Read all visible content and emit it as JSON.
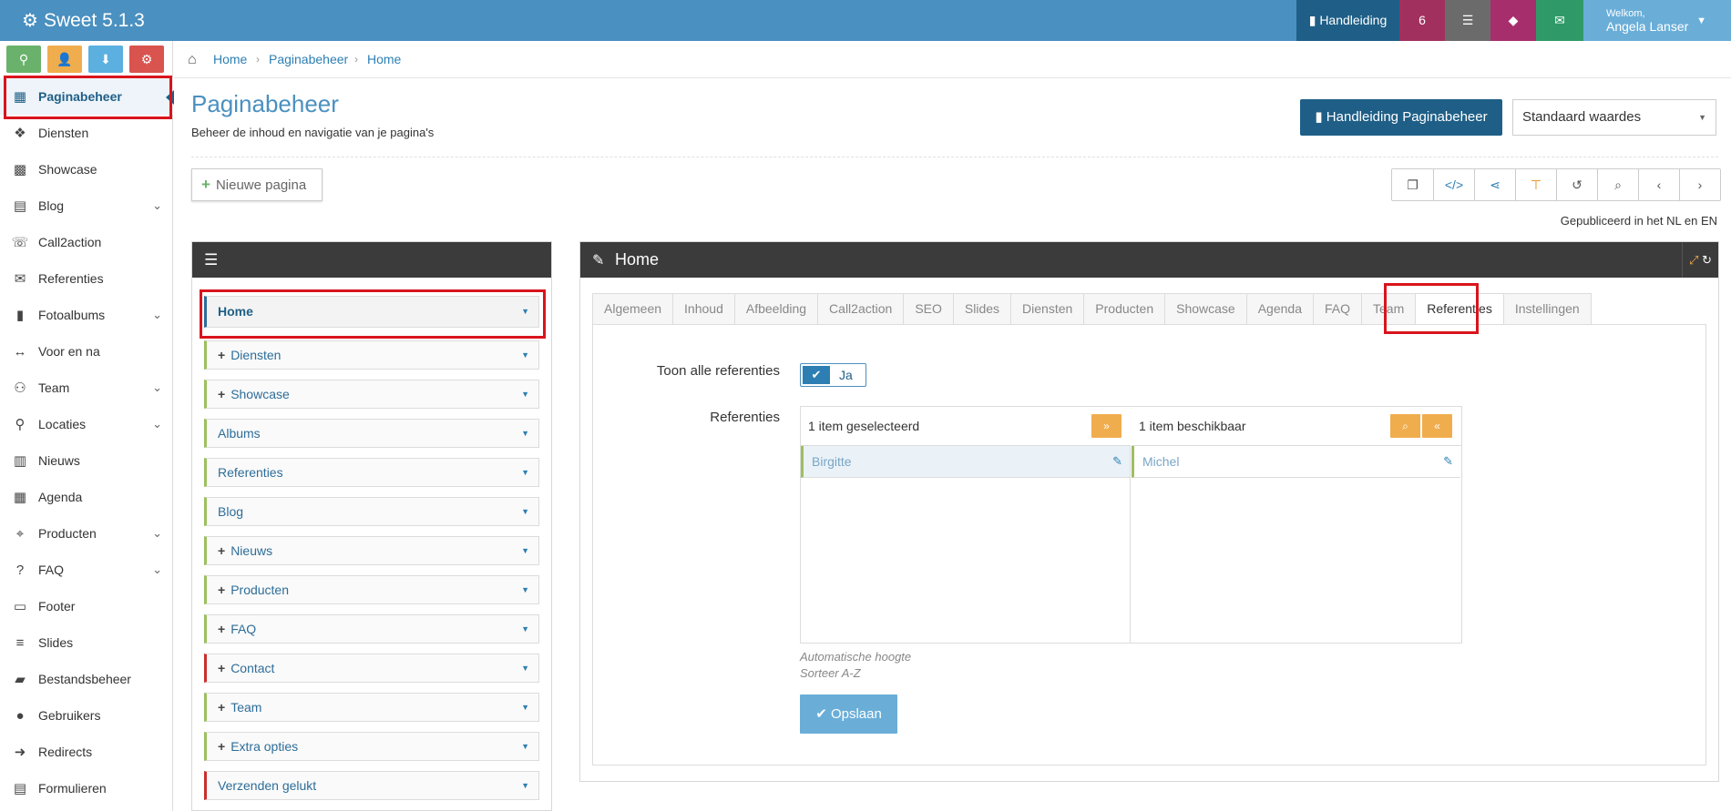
{
  "app": {
    "title": "Sweet 5.1.3"
  },
  "topbar": {
    "manual_label": "Handleiding",
    "count": "6",
    "welcome": "Welkom,",
    "user_name": "Angela Lanser"
  },
  "sidebar": {
    "items": [
      {
        "label": "Paginabeheer",
        "icon": "table-icon"
      },
      {
        "label": "Diensten",
        "icon": "cubes-icon"
      },
      {
        "label": "Showcase",
        "icon": "grid-icon"
      },
      {
        "label": "Blog",
        "icon": "document-icon"
      },
      {
        "label": "Call2action",
        "icon": "phone-icon"
      },
      {
        "label": "Referenties",
        "icon": "comments-icon"
      },
      {
        "label": "Fotoalbums",
        "icon": "book-icon"
      },
      {
        "label": "Voor en na",
        "icon": "arrows-h-icon"
      },
      {
        "label": "Team",
        "icon": "users-icon"
      },
      {
        "label": "Locaties",
        "icon": "map-marker-icon"
      },
      {
        "label": "Nieuws",
        "icon": "newspaper-icon"
      },
      {
        "label": "Agenda",
        "icon": "calendar-icon"
      },
      {
        "label": "Producten",
        "icon": "tags-icon"
      },
      {
        "label": "FAQ",
        "icon": "question-icon"
      },
      {
        "label": "Footer",
        "icon": "footer-icon"
      },
      {
        "label": "Slides",
        "icon": "sliders-icon"
      },
      {
        "label": "Bestandsbeheer",
        "icon": "folder-icon"
      },
      {
        "label": "Gebruikers",
        "icon": "user-icon"
      },
      {
        "label": "Redirects",
        "icon": "redirect-icon"
      },
      {
        "label": "Formulieren",
        "icon": "form-icon"
      }
    ]
  },
  "breadcrumb": [
    "Home",
    "Paginabeheer",
    "Home"
  ],
  "page": {
    "title": "Paginabeheer",
    "subtitle": "Beheer de inhoud en navigatie van je pagina's",
    "manual_button": "Handleiding Paginabeheer",
    "select_value": "Standaard waardes",
    "new_page": "Nieuwe pagina",
    "published": "Gepubliceerd in het NL en EN"
  },
  "tree": {
    "nodes": [
      {
        "label": "Home",
        "plus": false
      },
      {
        "label": "Diensten",
        "plus": true
      },
      {
        "label": "Showcase",
        "plus": true
      },
      {
        "label": "Albums",
        "plus": false
      },
      {
        "label": "Referenties",
        "plus": false
      },
      {
        "label": "Blog",
        "plus": false
      },
      {
        "label": "Nieuws",
        "plus": true
      },
      {
        "label": "Producten",
        "plus": true
      },
      {
        "label": "FAQ",
        "plus": true
      },
      {
        "label": "Contact",
        "plus": true
      },
      {
        "label": "Team",
        "plus": true
      },
      {
        "label": "Extra opties",
        "plus": true
      },
      {
        "label": "Verzenden gelukt",
        "plus": false
      }
    ]
  },
  "panel": {
    "title": "Home",
    "tabs": [
      "Algemeen",
      "Inhoud",
      "Afbeelding",
      "Call2action",
      "SEO",
      "Slides",
      "Diensten",
      "Producten",
      "Showcase",
      "Agenda",
      "FAQ",
      "Team",
      "Referenties",
      "Instellingen"
    ],
    "active_tab": "Referenties",
    "show_all_label": "Toon alle referenties",
    "show_all_value": "Ja",
    "refs_label": "Referenties",
    "selected_header": "1 item geselecteerd",
    "available_header": "1 item beschikbaar",
    "selected_items": [
      "Birgitte"
    ],
    "available_items": [
      "Michel"
    ],
    "hint_1": "Automatische hoogte",
    "hint_2": "Sorteer A-Z",
    "save_label": "Opslaan"
  },
  "colors": {
    "topbar": "#4a90c0",
    "accent": "#1f5f87",
    "orange": "#f0ad4e",
    "highlight": "#d9141c"
  }
}
